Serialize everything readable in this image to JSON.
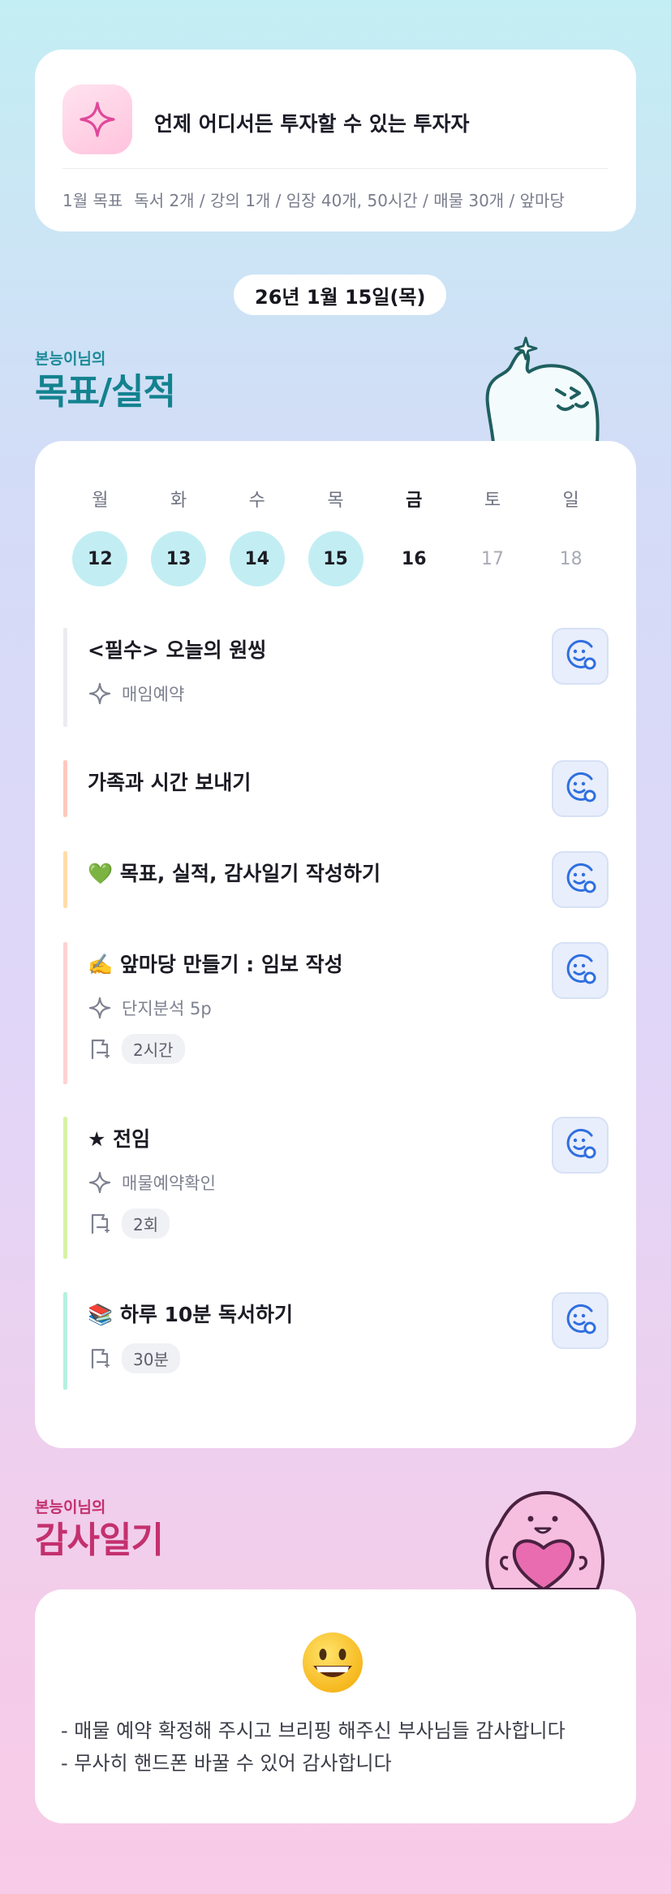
{
  "header": {
    "title": "언제 어디서든 투자할 수 있는 투자자",
    "goal_label": "1월 목표",
    "goal_text": "독서 2개 / 강의 1개 / 임장 40개, 50시간 / 매물 30개 / 앞마당"
  },
  "date": "26년 1월 15일(목)",
  "goals_section": {
    "subtitle": "본능이님의",
    "title": "목표/실적"
  },
  "week": [
    {
      "label": "월",
      "num": "12",
      "state": "done"
    },
    {
      "label": "화",
      "num": "13",
      "state": "done"
    },
    {
      "label": "수",
      "num": "14",
      "state": "done"
    },
    {
      "label": "목",
      "num": "15",
      "state": "done"
    },
    {
      "label": "금",
      "num": "16",
      "state": "today"
    },
    {
      "label": "토",
      "num": "17",
      "state": "future"
    },
    {
      "label": "일",
      "num": "18",
      "state": "future"
    }
  ],
  "tasks": [
    {
      "title": "<필수> 오늘의 원씽",
      "note": "매임예약",
      "chip": "",
      "bar_color": "#ececf0"
    },
    {
      "title": "가족과 시간 보내기",
      "note": "",
      "chip": "",
      "bar_color": "#ffc8bd"
    },
    {
      "title": "💚 목표, 실적, 감사일기 작성하기",
      "note": "",
      "chip": "",
      "bar_color": "#ffdcaa"
    },
    {
      "title": "✍️ 앞마당 만들기 : 임보 작성",
      "note": "단지분석 5p",
      "chip": "2시간",
      "bar_color": "#ffd2d2"
    },
    {
      "title": "★ 전임",
      "note": "매물예약확인",
      "chip": "2회",
      "bar_color": "#d8f2a8"
    },
    {
      "title": "📚 하루 10분 독서하기",
      "note": "",
      "chip": "30분",
      "bar_color": "#b6f0e1"
    }
  ],
  "thanks_section": {
    "subtitle": "본능이님의",
    "title": "감사일기"
  },
  "thanks": {
    "emoji": "😀",
    "lines": [
      "- 매물 예약 확정해 주시고 브리핑 해주신 부사님들 감사합니다",
      "- 무사히 핸드폰 바꿀 수 있어 감사합니다"
    ]
  },
  "colors": {
    "teal": "#13828f",
    "pink": "#c4306e",
    "done_day": "#c2eef3",
    "button_blue": "#2f6fe0"
  },
  "icons": {
    "logo": "sparkle-icon",
    "note": "sparkle-outline-icon",
    "time": "flag-icon",
    "check": "smile-add-icon"
  }
}
